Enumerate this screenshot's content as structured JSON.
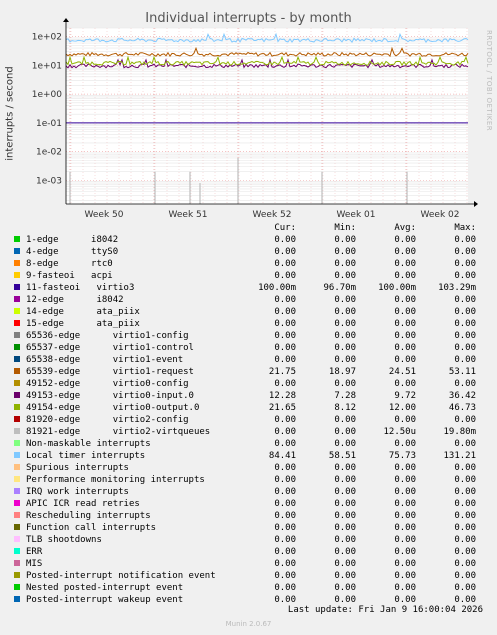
{
  "title": "Individual interrupts - by month",
  "ylabel": "interrupts / second",
  "watermark": "RRDTOOL / TOBI OETIKER",
  "footer": "Munin 2.0.67",
  "last_update": "Last update: Fri Jan  9 16:00:04 2026",
  "legend_headers": {
    "cur": "Cur:",
    "min": "Min:",
    "avg": "Avg:",
    "max": "Max:"
  },
  "chart_data": {
    "type": "line",
    "title": "Individual interrupts - by month",
    "ylabel": "interrupts / second",
    "yscale": "log",
    "ylim": [
      0.00015,
      200
    ],
    "yticks": [
      "1e+02",
      "1e+01",
      "1e+00",
      "1e-01",
      "1e-02",
      "1e-03"
    ],
    "ytick_values": [
      100,
      10,
      1,
      0.1,
      0.01,
      0.001
    ],
    "xticks": [
      "Week 50",
      "Week 51",
      "Week 52",
      "Week 01",
      "Week 02"
    ],
    "grid": true,
    "series": [
      {
        "name": "1-edge      i8042",
        "color": "#00cc00",
        "cur": "0.00",
        "min": "0.00",
        "avg": "0.00",
        "max": "0.00"
      },
      {
        "name": "4-edge      ttyS0",
        "color": "#0066b3",
        "cur": "0.00",
        "min": "0.00",
        "avg": "0.00",
        "max": "0.00"
      },
      {
        "name": "8-edge      rtc0",
        "color": "#ff8000",
        "cur": "0.00",
        "min": "0.00",
        "avg": "0.00",
        "max": "0.00"
      },
      {
        "name": "9-fasteoi   acpi",
        "color": "#ffcc00",
        "cur": "0.00",
        "min": "0.00",
        "avg": "0.00",
        "max": "0.00"
      },
      {
        "name": "11-fasteoi   virtio3",
        "color": "#330099",
        "cur": "100.00m",
        "min": "96.70m",
        "avg": "100.00m",
        "max": "103.29m",
        "level": 0.1
      },
      {
        "name": "12-edge      i8042",
        "color": "#990099",
        "cur": "0.00",
        "min": "0.00",
        "avg": "0.00",
        "max": "0.00"
      },
      {
        "name": "14-edge      ata_piix",
        "color": "#ccff00",
        "cur": "0.00",
        "min": "0.00",
        "avg": "0.00",
        "max": "0.00"
      },
      {
        "name": "15-edge      ata_piix",
        "color": "#ff0000",
        "cur": "0.00",
        "min": "0.00",
        "avg": "0.00",
        "max": "0.00"
      },
      {
        "name": "65536-edge      virtio1-config",
        "color": "#808080",
        "cur": "0.00",
        "min": "0.00",
        "avg": "0.00",
        "max": "0.00"
      },
      {
        "name": "65537-edge      virtio1-control",
        "color": "#008f00",
        "cur": "0.00",
        "min": "0.00",
        "avg": "0.00",
        "max": "0.00"
      },
      {
        "name": "65538-edge      virtio1-event",
        "color": "#00487d",
        "cur": "0.00",
        "min": "0.00",
        "avg": "0.00",
        "max": "0.00"
      },
      {
        "name": "65539-edge      virtio1-request",
        "color": "#b35a00",
        "cur": "21.75",
        "min": "18.97",
        "avg": "24.51",
        "max": "53.11",
        "level": 24.51
      },
      {
        "name": "49152-edge      virtio0-config",
        "color": "#b38f00",
        "cur": "0.00",
        "min": "0.00",
        "avg": "0.00",
        "max": "0.00"
      },
      {
        "name": "49153-edge      virtio0-input.0",
        "color": "#6b006b",
        "cur": "12.28",
        "min": "7.28",
        "avg": "9.72",
        "max": "36.42",
        "level": 9.72
      },
      {
        "name": "49154-edge      virtio0-output.0",
        "color": "#8fb300",
        "cur": "21.65",
        "min": "8.12",
        "avg": "12.00",
        "max": "46.73",
        "level": 12.0
      },
      {
        "name": "81920-edge      virtio2-config",
        "color": "#b30000",
        "cur": "0.00",
        "min": "0.00",
        "avg": "0.00",
        "max": "0.00"
      },
      {
        "name": "81921-edge      virtio2-virtqueues",
        "color": "#bebebe",
        "cur": "0.00",
        "min": "0.00",
        "avg": "12.50u",
        "max": "19.80m"
      },
      {
        "name": "Non-maskable interrupts",
        "color": "#80ff80",
        "cur": "0.00",
        "min": "0.00",
        "avg": "0.00",
        "max": "0.00"
      },
      {
        "name": "Local timer interrupts",
        "color": "#80c9ff",
        "cur": "84.41",
        "min": "58.51",
        "avg": "75.73",
        "max": "131.21",
        "level": 75.73
      },
      {
        "name": "Spurious interrupts",
        "color": "#ffc080",
        "cur": "0.00",
        "min": "0.00",
        "avg": "0.00",
        "max": "0.00"
      },
      {
        "name": "Performance monitoring interrupts",
        "color": "#ffe680",
        "cur": "0.00",
        "min": "0.00",
        "avg": "0.00",
        "max": "0.00"
      },
      {
        "name": "IRQ work interrupts",
        "color": "#aa80ff",
        "cur": "0.00",
        "min": "0.00",
        "avg": "0.00",
        "max": "0.00"
      },
      {
        "name": "APIC ICR read retries",
        "color": "#ee00cc",
        "cur": "0.00",
        "min": "0.00",
        "avg": "0.00",
        "max": "0.00"
      },
      {
        "name": "Rescheduling interrupts",
        "color": "#ff8080",
        "cur": "0.00",
        "min": "0.00",
        "avg": "0.00",
        "max": "0.00"
      },
      {
        "name": "Function call interrupts",
        "color": "#666600",
        "cur": "0.00",
        "min": "0.00",
        "avg": "0.00",
        "max": "0.00"
      },
      {
        "name": "TLB shootdowns",
        "color": "#ffbfff",
        "cur": "0.00",
        "min": "0.00",
        "avg": "0.00",
        "max": "0.00"
      },
      {
        "name": "ERR",
        "color": "#00ffcc",
        "cur": "0.00",
        "min": "0.00",
        "avg": "0.00",
        "max": "0.00"
      },
      {
        "name": "MIS",
        "color": "#cc6699",
        "cur": "0.00",
        "min": "0.00",
        "avg": "0.00",
        "max": "0.00"
      },
      {
        "name": "Posted-interrupt notification event",
        "color": "#999900",
        "cur": "0.00",
        "min": "0.00",
        "avg": "0.00",
        "max": "0.00"
      },
      {
        "name": "Nested posted-interrupt event",
        "color": "#00cc00",
        "cur": "0.00",
        "min": "0.00",
        "avg": "0.00",
        "max": "0.00"
      },
      {
        "name": "Posted-interrupt wakeup event",
        "color": "#0066b3",
        "cur": "0.00",
        "min": "0.00",
        "avg": "0.00",
        "max": "0.00"
      }
    ]
  }
}
